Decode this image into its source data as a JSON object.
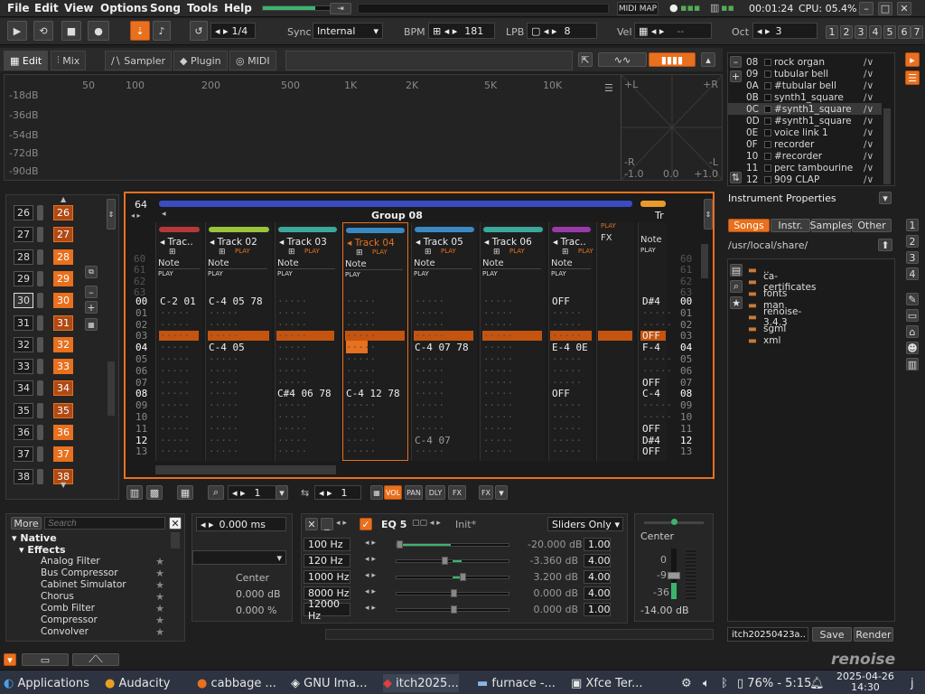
{
  "menu": [
    "File",
    "Edit",
    "View",
    "Options",
    "Song",
    "Tools",
    "Help"
  ],
  "top_right": {
    "midi_map": "MIDI MAP",
    "time": "00:01:24",
    "cpu": "CPU: 05.4%"
  },
  "toolbar": {
    "edit_step": "1/4",
    "sync_label": "Sync",
    "sync_value": "Internal",
    "bpm_label": "BPM",
    "bpm_value": "181",
    "lpb_label": "LPB",
    "lpb_value": "8",
    "vel_label": "Vel",
    "vel_value": "--",
    "oct_label": "Oct",
    "oct_value": "3",
    "oct_buttons": [
      "1",
      "2",
      "3",
      "4",
      "5",
      "6",
      "7"
    ]
  },
  "tabs": [
    "Edit",
    "Mix",
    "Sampler",
    "Plugin",
    "MIDI"
  ],
  "spectrum": {
    "db_labels": [
      "-18dB",
      "-36dB",
      "-54dB",
      "-72dB",
      "-90dB"
    ],
    "freq_labels": [
      "50",
      "100",
      "200",
      "500",
      "1K",
      "2K",
      "5K",
      "10K"
    ],
    "scope_labels": [
      "+L",
      "+R",
      "-R",
      "-L",
      "-1.0",
      "0.0",
      "+1.0"
    ]
  },
  "instruments": [
    {
      "id": "08",
      "name": "rock organ"
    },
    {
      "id": "09",
      "name": "tubular bell"
    },
    {
      "id": "0A",
      "name": "#tubular bell"
    },
    {
      "id": "0B",
      "name": "synth1_square"
    },
    {
      "id": "0C",
      "name": "#synth1_square"
    },
    {
      "id": "0D",
      "name": "#synth1_square"
    },
    {
      "id": "0E",
      "name": "voice link 1"
    },
    {
      "id": "0F",
      "name": "recorder"
    },
    {
      "id": "10",
      "name": "#recorder"
    },
    {
      "id": "11",
      "name": "perc tambourine"
    },
    {
      "id": "12",
      "name": "909 CLAP"
    }
  ],
  "instrument_properties": "Instrument Properties",
  "browser_tabs": [
    "Songs",
    "Instr.",
    "Samples",
    "Other"
  ],
  "browser_path": "/usr/local/share/",
  "folders": [
    "..",
    "ca-certificates",
    "fonts",
    "man",
    "renoise-3.4.3",
    "sgml",
    "xml"
  ],
  "song_field": "itch20250423a..",
  "save_label": "Save",
  "render_label": "Render",
  "sequencer": [
    {
      "num": "26",
      "pat": "26"
    },
    {
      "num": "27",
      "pat": "27"
    },
    {
      "num": "28",
      "pat": "28"
    },
    {
      "num": "29",
      "pat": "29"
    },
    {
      "num": "30",
      "pat": "30"
    },
    {
      "num": "31",
      "pat": "31"
    },
    {
      "num": "32",
      "pat": "32"
    },
    {
      "num": "33",
      "pat": "33"
    },
    {
      "num": "34",
      "pat": "34"
    },
    {
      "num": "35",
      "pat": "35"
    },
    {
      "num": "36",
      "pat": "36"
    },
    {
      "num": "37",
      "pat": "37"
    },
    {
      "num": "38",
      "pat": "38"
    }
  ],
  "pattern": {
    "lines": "64",
    "group": "Group 08",
    "tracks": [
      {
        "name": "Trac..",
        "color": "#b8383a"
      },
      {
        "name": "Track 02",
        "color": "#9ac43a"
      },
      {
        "name": "Track 03",
        "color": "#3aa89a"
      },
      {
        "name": "Track 04",
        "color": "#3a88c4"
      },
      {
        "name": "Track 05",
        "color": "#3a88c4"
      },
      {
        "name": "Track 06",
        "color": "#3aa89a"
      },
      {
        "name": "Trac..",
        "color": "#9a3aa8"
      }
    ],
    "note_label": "Note",
    "play_label": "PLAY",
    "fx_label": "FX",
    "last_track": "Tr",
    "row_numbers_top": [
      "60",
      "61",
      "62",
      "63"
    ],
    "row_numbers": [
      "00",
      "01",
      "02",
      "03",
      "04",
      "05",
      "06",
      "07",
      "08",
      "09",
      "10",
      "11",
      "12",
      "13"
    ],
    "cells": {
      "t1": {
        "00": "C-2 01"
      },
      "t2": {
        "00": "C-4 05 78",
        "04": "C-4 05"
      },
      "t3": {
        "08": "C#4 06 78"
      },
      "t4": {
        "08": "C-4 12 78"
      },
      "t5": {
        "04": "C-4 07 78",
        "12": "C-4 07"
      },
      "t6": {},
      "t7": {
        "00": "OFF",
        "04": "E-4 0E",
        "08": "OFF"
      },
      "t9": {
        "00": "D#4",
        "03": "OFF",
        "04": "F-4",
        "07": "OFF",
        "08": "C-4",
        "11": "OFF",
        "12": "D#4",
        "13": "OFF"
      }
    }
  },
  "pattern_toolbar": {
    "pat_num": "1",
    "step": "1",
    "buttons": [
      "VOL",
      "PAN",
      "DLY",
      "FX"
    ]
  },
  "effects": {
    "more": "More",
    "search_placeholder": "Search",
    "native": "Native",
    "effects_label": "Effects",
    "items": [
      "Analog Filter",
      "Bus Compressor",
      "Cabinet Simulator",
      "Chorus",
      "Comb Filter",
      "Compressor",
      "Convolver"
    ]
  },
  "track_dsp": {
    "delay": "0.000 ms",
    "center": "Center",
    "db": "0.000 dB",
    "pct": "0.000 %"
  },
  "eq": {
    "title": "EQ 5",
    "preset": "Init*",
    "mode": "Sliders Only",
    "bands": [
      {
        "freq": "100 Hz",
        "gain": "-20.000 dB",
        "q": "1.00",
        "pos": 0.0
      },
      {
        "freq": "120 Hz",
        "gain": "-3.360 dB",
        "q": "4.00",
        "pos": 0.42
      },
      {
        "freq": "1000 Hz",
        "gain": "3.200 dB",
        "q": "4.00",
        "pos": 0.58
      },
      {
        "freq": "8000 Hz",
        "gain": "0.000 dB",
        "q": "4.00",
        "pos": 0.5
      },
      {
        "freq": "12000 Hz",
        "gain": "0.000 dB",
        "q": "1.00",
        "pos": 0.5
      }
    ]
  },
  "master": {
    "pan": "Center",
    "scale": [
      "0",
      "-9",
      "-36"
    ],
    "volume": "-14.00 dB"
  },
  "taskbar": [
    "Applications",
    "Audacity",
    "cabbage ...",
    "GNU Ima...",
    "itch2025...",
    "furnace -...",
    "Xfce Ter..."
  ],
  "tray": {
    "battery": "76% - 5:15",
    "date": "2025-04-26",
    "time": "14:30",
    "user": "j"
  },
  "logo": "renoise",
  "colors": {
    "accent": "#e8701e",
    "bg": "#1f1f1f",
    "group": "#3a4cc4"
  }
}
